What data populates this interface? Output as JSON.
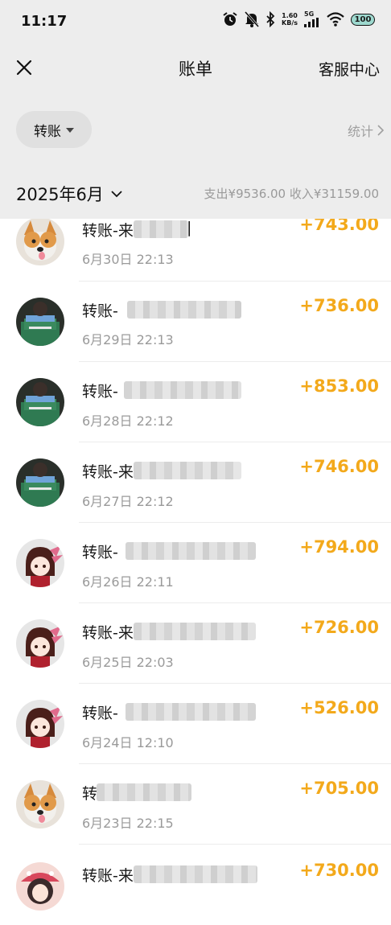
{
  "status_bar": {
    "time": "11:17",
    "net_speed_value": "1.60",
    "net_speed_unit": "KB/s",
    "network": "5G",
    "battery": "100"
  },
  "nav": {
    "title": "账单",
    "service": "客服中心"
  },
  "filter": {
    "chip_label": "转账",
    "stats_label": "统计"
  },
  "month": {
    "label": "2025年6月",
    "summary": "支出¥9536.00 收入¥31159.00"
  },
  "transactions": [
    {
      "title_prefix": "转账-来",
      "title_tail": "|",
      "date": "6月30日 22:13",
      "amount": "+743.00",
      "avatar": "dog-avatar"
    },
    {
      "title_prefix": "转账-",
      "title_tail": "",
      "date": "6月29日 22:13",
      "amount": "+736.00",
      "avatar": "person-green-avatar"
    },
    {
      "title_prefix": "转账-",
      "title_tail": "",
      "date": "6月28日 22:12",
      "amount": "+853.00",
      "avatar": "person-green-avatar"
    },
    {
      "title_prefix": "转账-来",
      "title_tail": "",
      "date": "6月27日 22:12",
      "amount": "+746.00",
      "avatar": "person-green-avatar"
    },
    {
      "title_prefix": "转账-",
      "title_tail": "",
      "date": "6月26日 22:11",
      "amount": "+794.00",
      "avatar": "anime-girl-avatar"
    },
    {
      "title_prefix": "转账-来",
      "title_tail": "",
      "date": "6月25日 22:03",
      "amount": "+726.00",
      "avatar": "anime-girl-avatar"
    },
    {
      "title_prefix": "转账-",
      "title_tail": "",
      "date": "6月24日 12:10",
      "amount": "+526.00",
      "avatar": "anime-girl-avatar"
    },
    {
      "title_prefix": "转",
      "title_tail": "",
      "date": "6月23日 22:15",
      "amount": "+705.00",
      "avatar": "dog-avatar"
    },
    {
      "title_prefix": "转账-来",
      "title_tail": "",
      "date": "",
      "amount": "+730.00",
      "avatar": "girl-hat-avatar"
    }
  ],
  "colors": {
    "amount": "#f3a91b",
    "header_bg": "#ededed",
    "muted": "#9a9a9a"
  }
}
